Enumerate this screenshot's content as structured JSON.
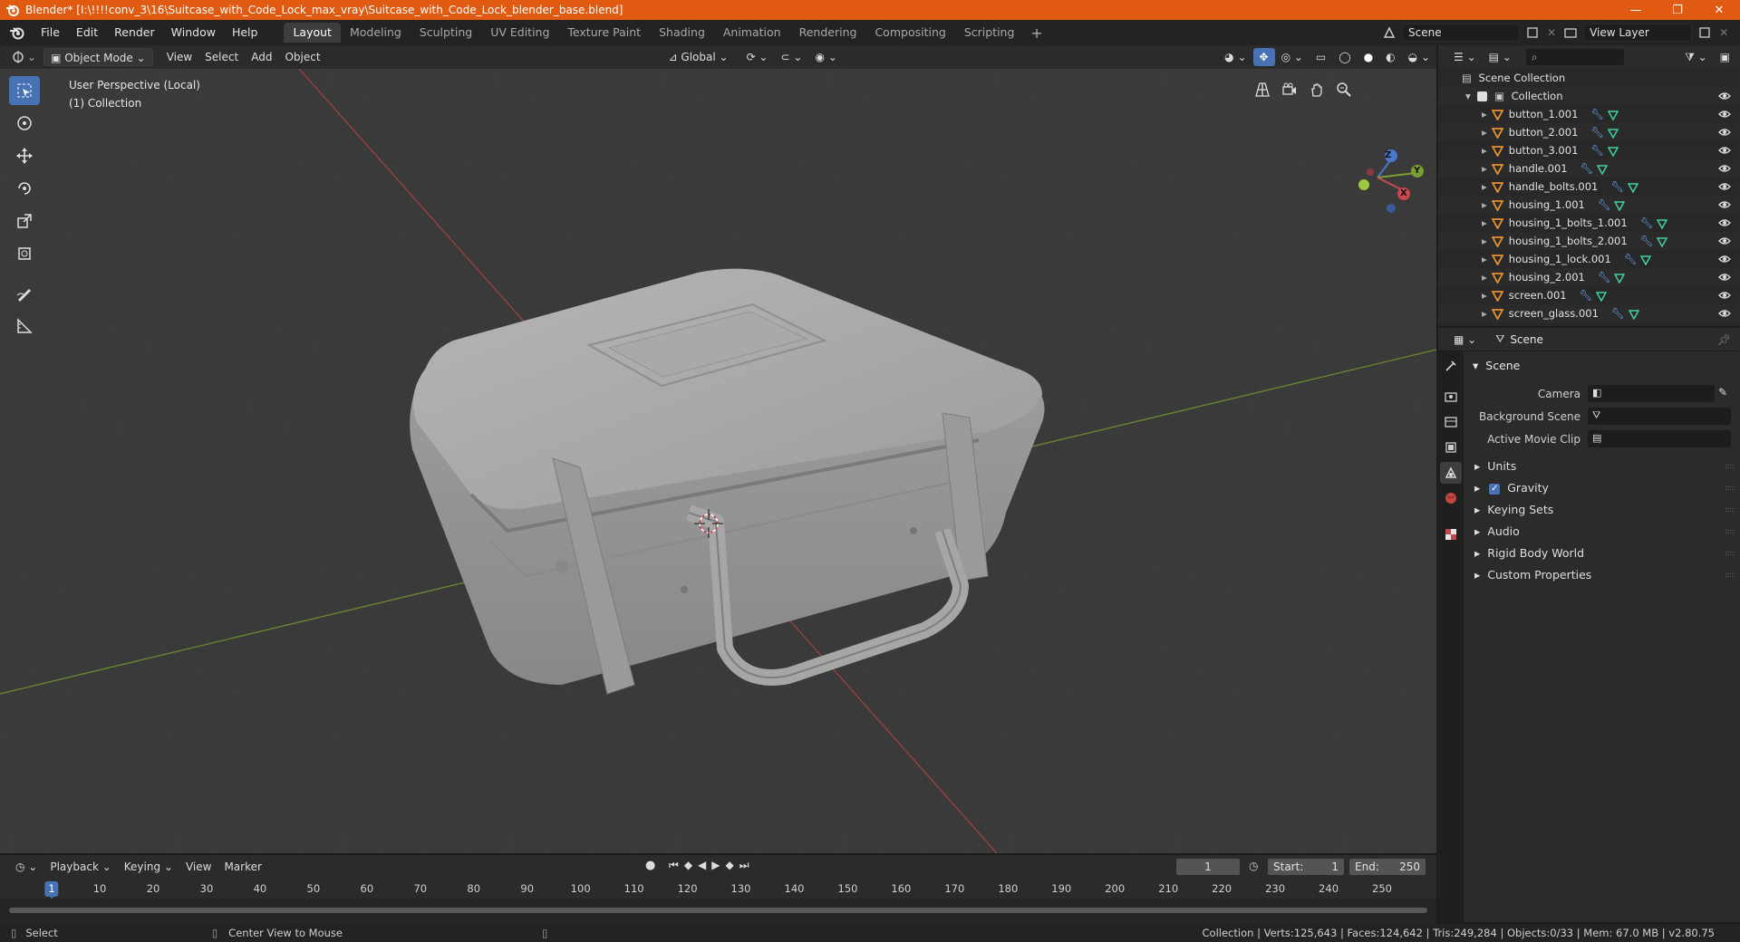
{
  "window": {
    "title": "Blender* [I:\\!!!!conv_3\\16\\Suitcase_with_Code_Lock_max_vray\\Suitcase_with_Code_Lock_blender_base.blend]",
    "minimize": "—",
    "maximize": "❐",
    "close": "✕"
  },
  "menu": {
    "items": [
      "File",
      "Edit",
      "Render",
      "Window",
      "Help"
    ],
    "workspaces": [
      "Layout",
      "Modeling",
      "Sculpting",
      "UV Editing",
      "Texture Paint",
      "Shading",
      "Animation",
      "Rendering",
      "Compositing",
      "Scripting"
    ],
    "active_workspace": "Layout",
    "add": "+",
    "scene": "Scene",
    "view_layer": "View Layer"
  },
  "viewport_header": {
    "mode": "Object Mode",
    "menus": [
      "View",
      "Select",
      "Add",
      "Object"
    ],
    "orientation": "Global"
  },
  "viewport": {
    "perspective": "User Perspective (Local)",
    "collection": "(1) Collection",
    "gizmo": {
      "z": "Z",
      "y": "Y",
      "x": "X"
    }
  },
  "outliner": {
    "search_placeholder": "",
    "root": "Scene Collection",
    "collection": "Collection",
    "objects": [
      "button_1.001",
      "button_2.001",
      "button_3.001",
      "handle.001",
      "handle_bolts.001",
      "housing_1.001",
      "housing_1_bolts_1.001",
      "housing_1_bolts_2.001",
      "housing_1_lock.001",
      "housing_2.001",
      "screen.001",
      "screen_glass.001"
    ]
  },
  "properties": {
    "context": "Scene",
    "panel": "Scene",
    "fields": [
      {
        "label": "Camera",
        "value": ""
      },
      {
        "label": "Background Scene",
        "value": ""
      },
      {
        "label": "Active Movie Clip",
        "value": ""
      }
    ],
    "subpanels": [
      "Units",
      "Gravity",
      "Keying Sets",
      "Audio",
      "Rigid Body World",
      "Custom Properties"
    ],
    "gravity_checked": true
  },
  "timeline": {
    "menus": [
      "Playback",
      "Keying",
      "View",
      "Marker"
    ],
    "current_frame": "1",
    "start_label": "Start:",
    "start": "1",
    "end_label": "End:",
    "end": "250",
    "ticks": [
      "1",
      "10",
      "20",
      "30",
      "40",
      "50",
      "60",
      "70",
      "80",
      "90",
      "100",
      "110",
      "120",
      "130",
      "140",
      "150",
      "160",
      "170",
      "180",
      "190",
      "200",
      "210",
      "220",
      "230",
      "240",
      "250"
    ]
  },
  "status": {
    "left": "Select",
    "middle": "Center View to Mouse",
    "right": "Collection | Verts:125,643 | Faces:124,642 | Tris:249,284 | Objects:0/33 | Mem: 67.0 MB | v2.80.75"
  },
  "colors": {
    "titlebar": "#e05a12",
    "accent": "#4772b3",
    "mesh_icon": "#e8912e",
    "modifier_icon": "#6fa8ff",
    "data_icon": "#3fd0a0"
  }
}
